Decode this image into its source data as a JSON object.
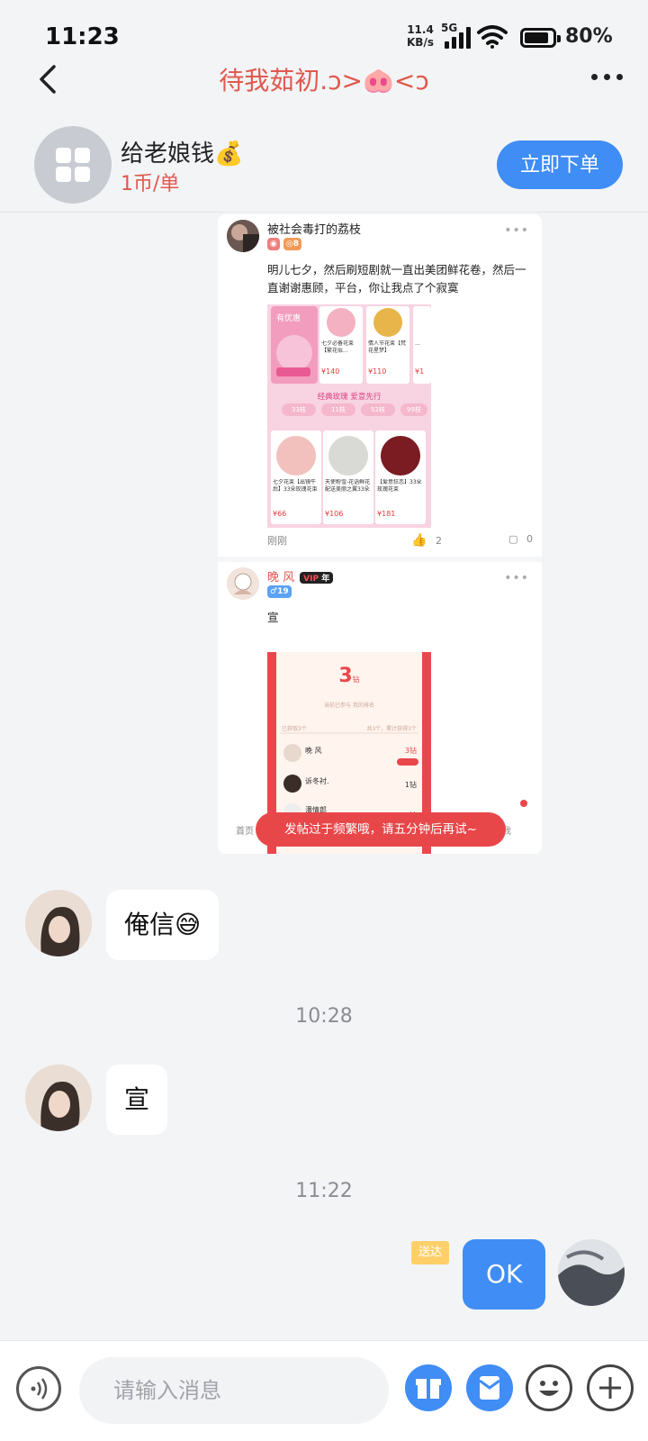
{
  "status_bar": {
    "time": "11:23",
    "net_speed_value": "11.4",
    "net_speed_unit": "KB/s",
    "network": "5G",
    "battery": "80%"
  },
  "nav": {
    "title": "待我茹初.ↄ>🐽<ↄ"
  },
  "service": {
    "title": "给老娘钱💰",
    "price": "1币/单",
    "order_button": "立即下单"
  },
  "shared_card": {
    "post1": {
      "author": "被社会毒打的荔枝",
      "level_badge": "8",
      "text": "明儿七夕，然后刷短剧就一直出美团鲜花卷，然后一直谢谢惠顾，平台，你让我点了个寂寞",
      "time": "刚刚",
      "likes": "2",
      "comments": "0",
      "image": {
        "banner_title": "有优惠",
        "section_title": "经典玫瑰 爱意先行",
        "tabs": [
          "33枝",
          "11枝",
          "52枝",
          "99枝"
        ],
        "products_top": [
          {
            "desc": "七夕必备花束【繁花似…",
            "price": "¥140"
          },
          {
            "desc": "情人节花束【梵花星梦】",
            "price": "¥110"
          },
          {
            "desc": "…",
            "price": "¥1"
          }
        ],
        "products_bottom": [
          {
            "desc": "七夕花束【出镜午后】33朵玫瑰花束",
            "price": "¥66"
          },
          {
            "desc": "天使粉雪-花语鲜花配送美丽之翼33朵",
            "price": "¥106"
          },
          {
            "desc": "【爱意狂恋】33朵玫瑰花束",
            "price": "¥181"
          }
        ]
      }
    },
    "post2": {
      "author": "晚 风",
      "vip": "VIP",
      "vip_suffix": "年",
      "level_badge": "19",
      "text": "宣",
      "image": {
        "big_value": "3",
        "big_unit": "钻",
        "sub": "当前已参与 我的排名",
        "header_left": "已获取3个",
        "header_right": "共3个，累计获得3个",
        "rows": [
          {
            "name": "晚 风",
            "value": "3钻"
          },
          {
            "name": "诉冬衬.",
            "value": "1钻"
          },
          {
            "name": "潘情郎",
            "value": "1钻"
          }
        ],
        "nav_left": "首页",
        "nav_right": "我"
      }
    },
    "toast": "发帖过于频繁哦，请五分钟后再试~"
  },
  "messages": [
    {
      "side": "left",
      "text": "俺信😅"
    },
    {
      "type": "time",
      "text": "10:28"
    },
    {
      "side": "left",
      "text": "宣"
    },
    {
      "type": "time",
      "text": "11:22"
    },
    {
      "side": "right",
      "text": "OK",
      "status": "送达"
    }
  ],
  "input": {
    "placeholder": "请输入消息"
  },
  "colors": {
    "accent": "#3f8df5",
    "title_red": "#e0584e",
    "toast_red": "#e8474a",
    "delivered_tag": "#ffd06a"
  }
}
